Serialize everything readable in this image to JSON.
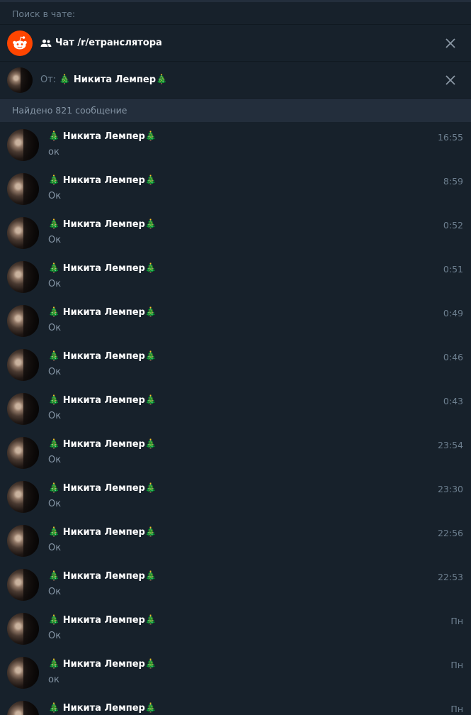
{
  "search": {
    "header_label": "Поиск в чате:"
  },
  "chat_filter": {
    "label": "Чат /r/етранслятора"
  },
  "from_filter": {
    "prefix": "От:",
    "name": "🎄 Никита Лемпер🎄"
  },
  "results": {
    "count_label": "Найдено 821 сообщение"
  },
  "messages": [
    {
      "sender": "🎄 Никита Лемпер🎄",
      "text": "ок",
      "time": "16:55"
    },
    {
      "sender": "🎄 Никита Лемпер🎄",
      "text": "Ок",
      "time": "8:59"
    },
    {
      "sender": "🎄 Никита Лемпер🎄",
      "text": "Ок",
      "time": "0:52"
    },
    {
      "sender": "🎄 Никита Лемпер🎄",
      "text": "Ок",
      "time": "0:51"
    },
    {
      "sender": "🎄 Никита Лемпер🎄",
      "text": "Ок",
      "time": "0:49"
    },
    {
      "sender": "🎄 Никита Лемпер🎄",
      "text": "Ок",
      "time": "0:46"
    },
    {
      "sender": "🎄 Никита Лемпер🎄",
      "text": "Ок",
      "time": "0:43"
    },
    {
      "sender": "🎄 Никита Лемпер🎄",
      "text": "Ок",
      "time": "23:54"
    },
    {
      "sender": "🎄 Никита Лемпер🎄",
      "text": "Ок",
      "time": "23:30"
    },
    {
      "sender": "🎄 Никита Лемпер🎄",
      "text": "Ок",
      "time": "22:56"
    },
    {
      "sender": "🎄 Никита Лемпер🎄",
      "text": "Ок",
      "time": "22:53"
    },
    {
      "sender": "🎄 Никита Лемпер🎄",
      "text": "Ок",
      "time": "Пн"
    },
    {
      "sender": "🎄 Никита Лемпер🎄",
      "text": "ок",
      "time": "Пн"
    },
    {
      "sender": "🎄 Никита Лемпер🎄",
      "text": "",
      "time": "Пн"
    }
  ],
  "colors": {
    "background": "#17212b",
    "header_bar": "#232e3c",
    "reddit_orange": "#ff4500",
    "secondary_text": "#8696a6"
  },
  "icons": {
    "chat_avatar": "reddit-logo-icon",
    "chat_type": "group-icon",
    "close": "close-icon"
  }
}
